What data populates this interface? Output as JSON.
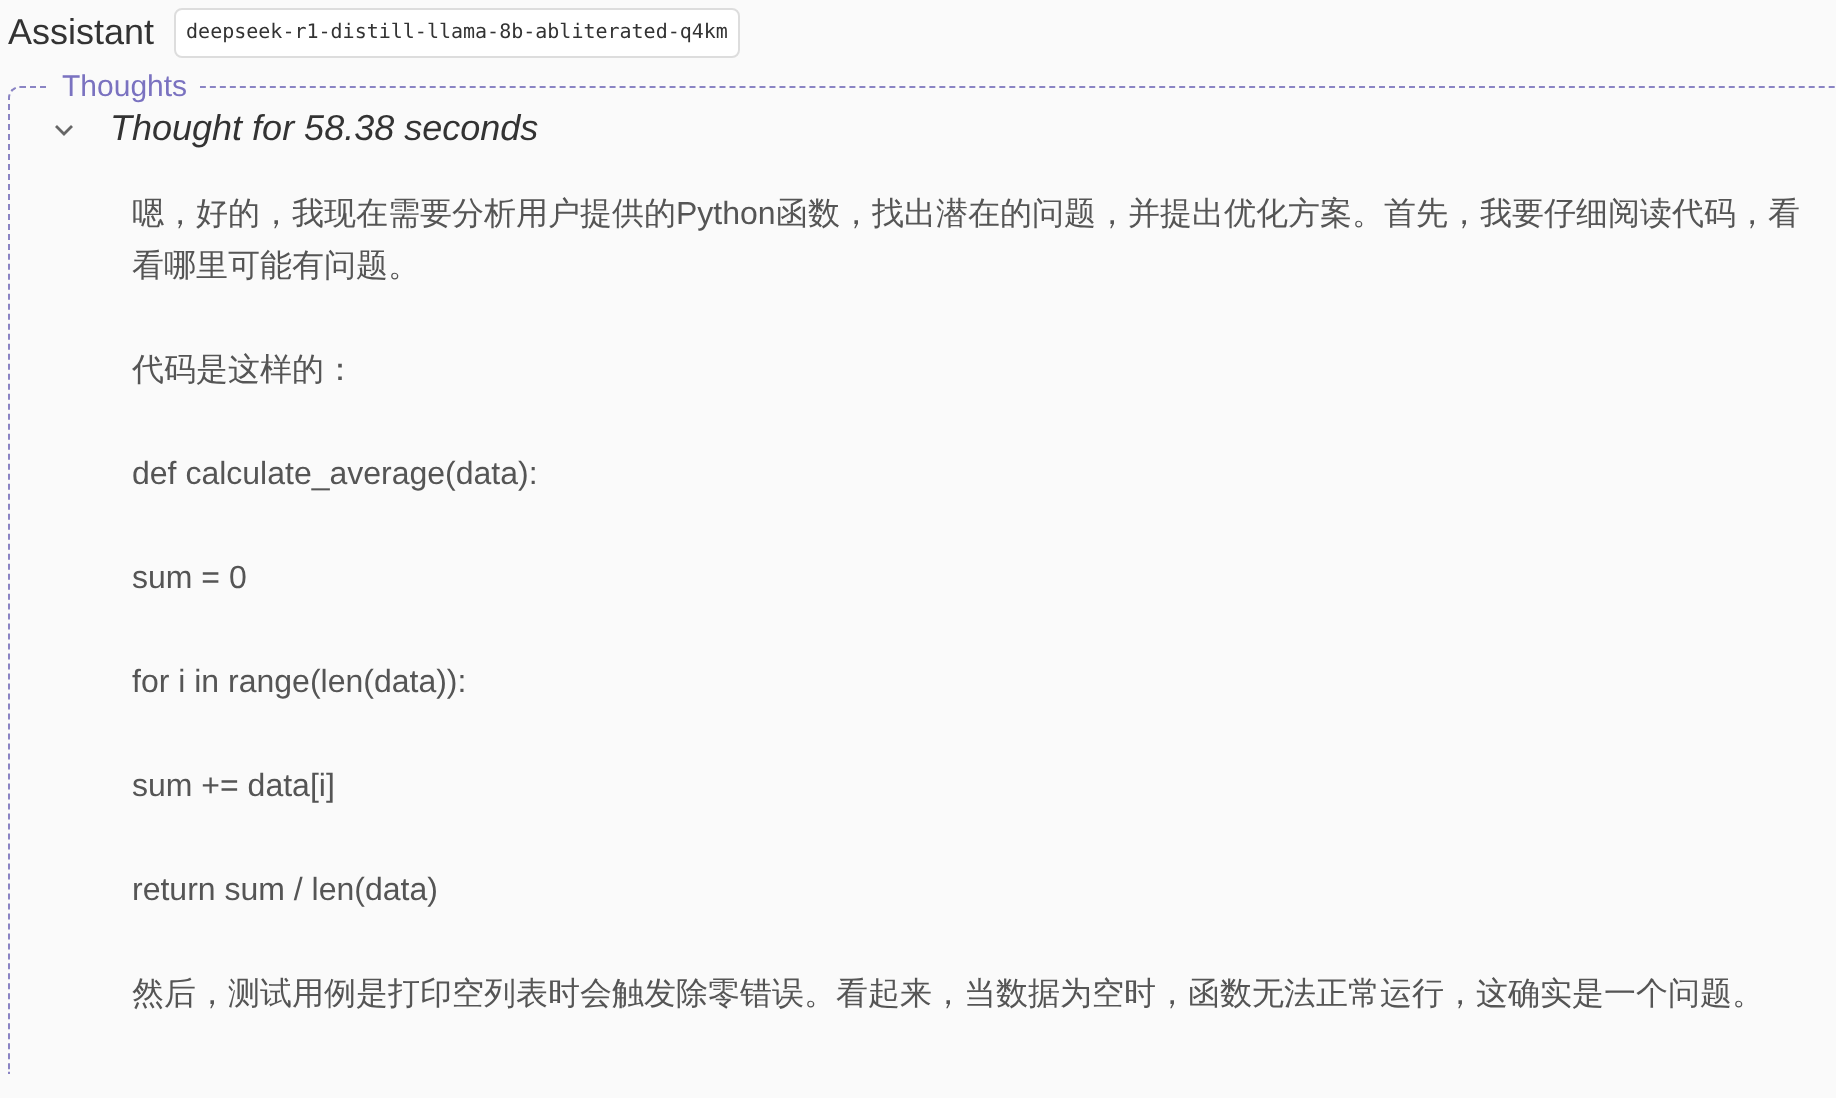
{
  "header": {
    "role": "Assistant",
    "model": "deepseek-r1-distill-llama-8b-abliterated-q4km"
  },
  "thoughts": {
    "legend": "Thoughts",
    "expanded": true,
    "summary": "Thought for 58.38 seconds",
    "paragraphs": [
      "嗯，好的，我现在需要分析用户提供的Python函数，找出潜在的问题，并提出优化方案。首先，我要仔细阅读代码，看看哪里可能有问题。",
      "代码是这样的：",
      "def calculate_average(data):",
      "sum = 0",
      "for i in range(len(data)):",
      "sum += data[i]",
      "return sum / len(data)",
      "然后，测试用例是打印空列表时会触发除零错误。看起来，当数据为空时，函数无法正常运行，这确实是一个问题。"
    ]
  }
}
